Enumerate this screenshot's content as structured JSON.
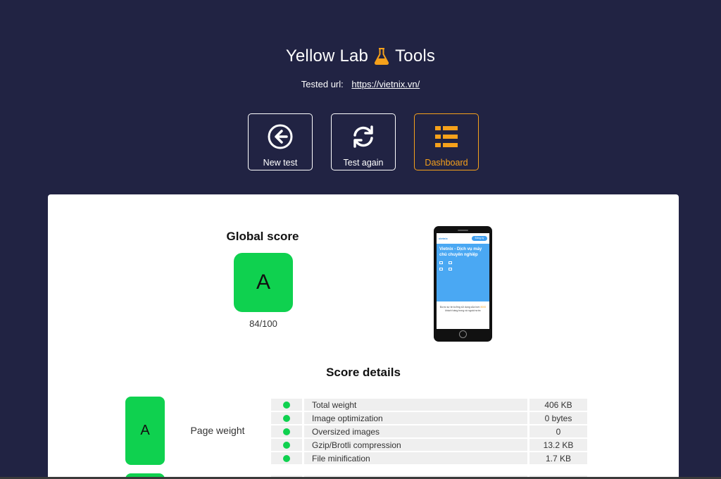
{
  "header": {
    "title_left": "Yellow Lab",
    "title_right": "Tools",
    "tested_label": "Tested url:",
    "tested_url": "https://vietnix.vn/"
  },
  "actions": [
    {
      "label": "New test",
      "icon": "arrow-left-circle-icon"
    },
    {
      "label": "Test again",
      "icon": "refresh-icon"
    },
    {
      "label": "Dashboard",
      "icon": "list-icon",
      "active": true
    }
  ],
  "global": {
    "title": "Global score",
    "grade": "A",
    "score": "84/100"
  },
  "phone_preview": {
    "logo": "vietnix",
    "pill": "Đăng ký",
    "hero_title": "Vietnix - Dịch vụ máy chủ chuyên nghiệp",
    "body_text_before": "Được sự tin tưởng sử dụng của hơn",
    "body_highlight": "5000",
    "body_text_after": "khách hàng trong và ngoài nước"
  },
  "details": {
    "title": "Score details",
    "categories": [
      {
        "grade": "A",
        "label": "Page weight",
        "rules": [
          {
            "name": "Total weight",
            "value": "406 KB"
          },
          {
            "name": "Image optimization",
            "value": "0 bytes"
          },
          {
            "name": "Oversized images",
            "value": "0"
          },
          {
            "name": "Gzip/Brotli compression",
            "value": "13.2 KB"
          },
          {
            "name": "File minification",
            "value": "1.7 KB"
          }
        ]
      }
    ]
  },
  "colors": {
    "background": "#212343",
    "accent": "#f6a11b",
    "grade_a": "#0fd14f",
    "panel": "#ffffff"
  }
}
